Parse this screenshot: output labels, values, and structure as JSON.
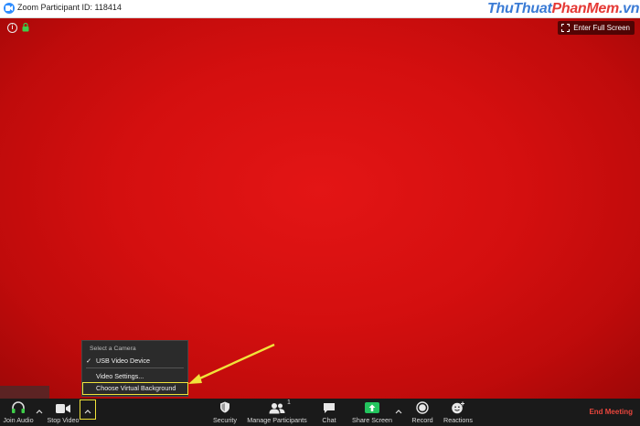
{
  "window": {
    "title": "Zoom Participant ID: 118414",
    "watermark": {
      "part1": "ThuThuat",
      "part2": "PhanMem",
      "part3": ".vn"
    }
  },
  "video": {
    "fullscreen_label": "Enter Full Screen",
    "background_color": "#d40f0f"
  },
  "camera_menu": {
    "header": "Select a Camera",
    "devices": [
      {
        "label": "USB Video Device",
        "selected": true
      }
    ],
    "settings_label": "Video Settings...",
    "virtual_background_label": "Choose Virtual Background"
  },
  "toolbar": {
    "join_audio": "Join Audio",
    "stop_video": "Stop Video",
    "security": "Security",
    "manage_participants": "Manage Participants",
    "participant_count": "1",
    "chat": "Chat",
    "share_screen": "Share Screen",
    "record": "Record",
    "reactions": "Reactions",
    "end_meeting": "End Meeting"
  },
  "colors": {
    "highlight": "#f1e33a",
    "end_meeting": "#e8453c",
    "share_green": "#23c45e",
    "zoom_blue": "#2d8cff"
  }
}
